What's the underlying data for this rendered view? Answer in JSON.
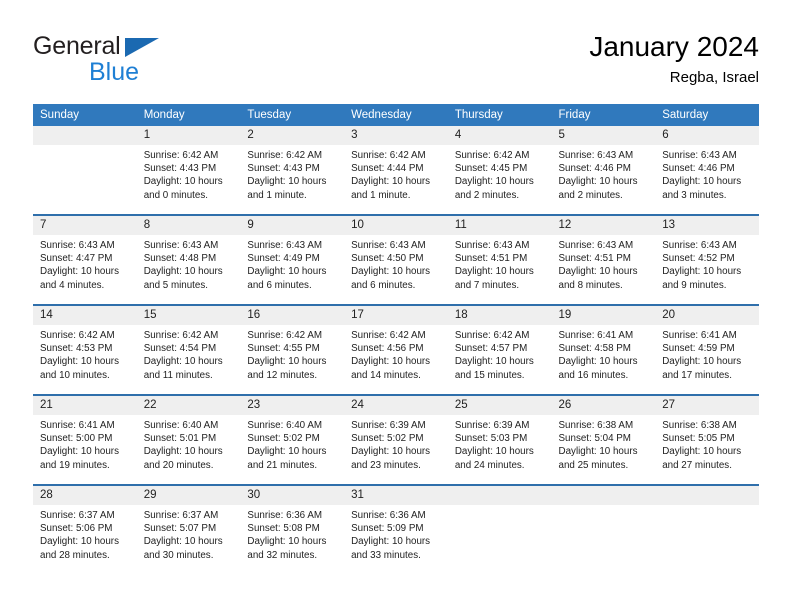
{
  "brand": {
    "word1": "General",
    "word2": "Blue",
    "triangle_color": "#1b69b1",
    "word2_color": "#1e7fd4"
  },
  "header": {
    "title": "January 2024",
    "subtitle": "Regba, Israel"
  },
  "theme": {
    "header_bg": "#3079bd",
    "row_divider": "#2f6fab",
    "daynum_bg": "#efefef",
    "text": "#222222"
  },
  "weekday_headers": [
    "Sunday",
    "Monday",
    "Tuesday",
    "Wednesday",
    "Thursday",
    "Friday",
    "Saturday"
  ],
  "labels": {
    "sunrise_prefix": "Sunrise:",
    "sunset_prefix": "Sunset:",
    "daylight_prefix": "Daylight:"
  },
  "weeks": [
    [
      {
        "day": "",
        "sunrise": "",
        "sunset": "",
        "daylight_line1": "",
        "daylight_line2": ""
      },
      {
        "day": "1",
        "sunrise": "Sunrise: 6:42 AM",
        "sunset": "Sunset: 4:43 PM",
        "daylight_line1": "Daylight: 10 hours",
        "daylight_line2": "and 0 minutes."
      },
      {
        "day": "2",
        "sunrise": "Sunrise: 6:42 AM",
        "sunset": "Sunset: 4:43 PM",
        "daylight_line1": "Daylight: 10 hours",
        "daylight_line2": "and 1 minute."
      },
      {
        "day": "3",
        "sunrise": "Sunrise: 6:42 AM",
        "sunset": "Sunset: 4:44 PM",
        "daylight_line1": "Daylight: 10 hours",
        "daylight_line2": "and 1 minute."
      },
      {
        "day": "4",
        "sunrise": "Sunrise: 6:42 AM",
        "sunset": "Sunset: 4:45 PM",
        "daylight_line1": "Daylight: 10 hours",
        "daylight_line2": "and 2 minutes."
      },
      {
        "day": "5",
        "sunrise": "Sunrise: 6:43 AM",
        "sunset": "Sunset: 4:46 PM",
        "daylight_line1": "Daylight: 10 hours",
        "daylight_line2": "and 2 minutes."
      },
      {
        "day": "6",
        "sunrise": "Sunrise: 6:43 AM",
        "sunset": "Sunset: 4:46 PM",
        "daylight_line1": "Daylight: 10 hours",
        "daylight_line2": "and 3 minutes."
      }
    ],
    [
      {
        "day": "7",
        "sunrise": "Sunrise: 6:43 AM",
        "sunset": "Sunset: 4:47 PM",
        "daylight_line1": "Daylight: 10 hours",
        "daylight_line2": "and 4 minutes."
      },
      {
        "day": "8",
        "sunrise": "Sunrise: 6:43 AM",
        "sunset": "Sunset: 4:48 PM",
        "daylight_line1": "Daylight: 10 hours",
        "daylight_line2": "and 5 minutes."
      },
      {
        "day": "9",
        "sunrise": "Sunrise: 6:43 AM",
        "sunset": "Sunset: 4:49 PM",
        "daylight_line1": "Daylight: 10 hours",
        "daylight_line2": "and 6 minutes."
      },
      {
        "day": "10",
        "sunrise": "Sunrise: 6:43 AM",
        "sunset": "Sunset: 4:50 PM",
        "daylight_line1": "Daylight: 10 hours",
        "daylight_line2": "and 6 minutes."
      },
      {
        "day": "11",
        "sunrise": "Sunrise: 6:43 AM",
        "sunset": "Sunset: 4:51 PM",
        "daylight_line1": "Daylight: 10 hours",
        "daylight_line2": "and 7 minutes."
      },
      {
        "day": "12",
        "sunrise": "Sunrise: 6:43 AM",
        "sunset": "Sunset: 4:51 PM",
        "daylight_line1": "Daylight: 10 hours",
        "daylight_line2": "and 8 minutes."
      },
      {
        "day": "13",
        "sunrise": "Sunrise: 6:43 AM",
        "sunset": "Sunset: 4:52 PM",
        "daylight_line1": "Daylight: 10 hours",
        "daylight_line2": "and 9 minutes."
      }
    ],
    [
      {
        "day": "14",
        "sunrise": "Sunrise: 6:42 AM",
        "sunset": "Sunset: 4:53 PM",
        "daylight_line1": "Daylight: 10 hours",
        "daylight_line2": "and 10 minutes."
      },
      {
        "day": "15",
        "sunrise": "Sunrise: 6:42 AM",
        "sunset": "Sunset: 4:54 PM",
        "daylight_line1": "Daylight: 10 hours",
        "daylight_line2": "and 11 minutes."
      },
      {
        "day": "16",
        "sunrise": "Sunrise: 6:42 AM",
        "sunset": "Sunset: 4:55 PM",
        "daylight_line1": "Daylight: 10 hours",
        "daylight_line2": "and 12 minutes."
      },
      {
        "day": "17",
        "sunrise": "Sunrise: 6:42 AM",
        "sunset": "Sunset: 4:56 PM",
        "daylight_line1": "Daylight: 10 hours",
        "daylight_line2": "and 14 minutes."
      },
      {
        "day": "18",
        "sunrise": "Sunrise: 6:42 AM",
        "sunset": "Sunset: 4:57 PM",
        "daylight_line1": "Daylight: 10 hours",
        "daylight_line2": "and 15 minutes."
      },
      {
        "day": "19",
        "sunrise": "Sunrise: 6:41 AM",
        "sunset": "Sunset: 4:58 PM",
        "daylight_line1": "Daylight: 10 hours",
        "daylight_line2": "and 16 minutes."
      },
      {
        "day": "20",
        "sunrise": "Sunrise: 6:41 AM",
        "sunset": "Sunset: 4:59 PM",
        "daylight_line1": "Daylight: 10 hours",
        "daylight_line2": "and 17 minutes."
      }
    ],
    [
      {
        "day": "21",
        "sunrise": "Sunrise: 6:41 AM",
        "sunset": "Sunset: 5:00 PM",
        "daylight_line1": "Daylight: 10 hours",
        "daylight_line2": "and 19 minutes."
      },
      {
        "day": "22",
        "sunrise": "Sunrise: 6:40 AM",
        "sunset": "Sunset: 5:01 PM",
        "daylight_line1": "Daylight: 10 hours",
        "daylight_line2": "and 20 minutes."
      },
      {
        "day": "23",
        "sunrise": "Sunrise: 6:40 AM",
        "sunset": "Sunset: 5:02 PM",
        "daylight_line1": "Daylight: 10 hours",
        "daylight_line2": "and 21 minutes."
      },
      {
        "day": "24",
        "sunrise": "Sunrise: 6:39 AM",
        "sunset": "Sunset: 5:02 PM",
        "daylight_line1": "Daylight: 10 hours",
        "daylight_line2": "and 23 minutes."
      },
      {
        "day": "25",
        "sunrise": "Sunrise: 6:39 AM",
        "sunset": "Sunset: 5:03 PM",
        "daylight_line1": "Daylight: 10 hours",
        "daylight_line2": "and 24 minutes."
      },
      {
        "day": "26",
        "sunrise": "Sunrise: 6:38 AM",
        "sunset": "Sunset: 5:04 PM",
        "daylight_line1": "Daylight: 10 hours",
        "daylight_line2": "and 25 minutes."
      },
      {
        "day": "27",
        "sunrise": "Sunrise: 6:38 AM",
        "sunset": "Sunset: 5:05 PM",
        "daylight_line1": "Daylight: 10 hours",
        "daylight_line2": "and 27 minutes."
      }
    ],
    [
      {
        "day": "28",
        "sunrise": "Sunrise: 6:37 AM",
        "sunset": "Sunset: 5:06 PM",
        "daylight_line1": "Daylight: 10 hours",
        "daylight_line2": "and 28 minutes."
      },
      {
        "day": "29",
        "sunrise": "Sunrise: 6:37 AM",
        "sunset": "Sunset: 5:07 PM",
        "daylight_line1": "Daylight: 10 hours",
        "daylight_line2": "and 30 minutes."
      },
      {
        "day": "30",
        "sunrise": "Sunrise: 6:36 AM",
        "sunset": "Sunset: 5:08 PM",
        "daylight_line1": "Daylight: 10 hours",
        "daylight_line2": "and 32 minutes."
      },
      {
        "day": "31",
        "sunrise": "Sunrise: 6:36 AM",
        "sunset": "Sunset: 5:09 PM",
        "daylight_line1": "Daylight: 10 hours",
        "daylight_line2": "and 33 minutes."
      },
      {
        "day": "",
        "sunrise": "",
        "sunset": "",
        "daylight_line1": "",
        "daylight_line2": ""
      },
      {
        "day": "",
        "sunrise": "",
        "sunset": "",
        "daylight_line1": "",
        "daylight_line2": ""
      },
      {
        "day": "",
        "sunrise": "",
        "sunset": "",
        "daylight_line1": "",
        "daylight_line2": ""
      }
    ]
  ]
}
